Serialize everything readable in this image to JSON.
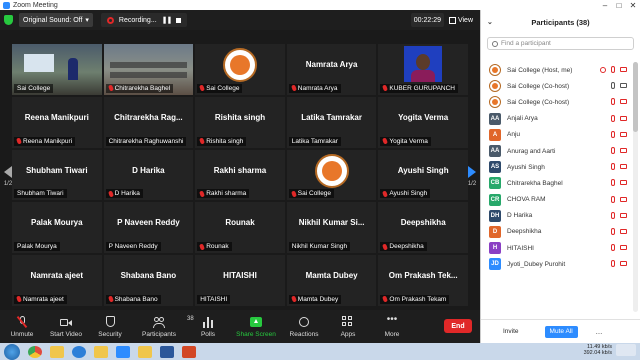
{
  "window": {
    "title": "Zoom Meeting"
  },
  "topbar": {
    "sound_label": "Original Sound: Off",
    "recording_label": "Recording...",
    "timer": "00:22:29",
    "view_label": "View"
  },
  "gallery": {
    "tiles": [
      {
        "big": "",
        "name": "Sai College",
        "muted": false,
        "kind": "classroom"
      },
      {
        "big": "",
        "name": "Chitrarekha Baghel",
        "muted": true,
        "kind": "classroom2"
      },
      {
        "big": "",
        "name": "Sai College",
        "muted": true,
        "kind": "logo"
      },
      {
        "big": "Namrata Arya",
        "name": "Namrata Arya",
        "muted": true,
        "kind": "text"
      },
      {
        "big": "",
        "name": "KUBER GURUPANCH",
        "muted": true,
        "kind": "portrait"
      },
      {
        "big": "Reena Manikpuri",
        "name": "Reena Manikpuri",
        "muted": true,
        "kind": "text"
      },
      {
        "big": "Chitrarekha Rag...",
        "name": "Chitrarekha Raghuwanshi",
        "muted": false,
        "kind": "text"
      },
      {
        "big": "Rishita singh",
        "name": "Rishita singh",
        "muted": true,
        "kind": "text"
      },
      {
        "big": "Latika Tamrakar",
        "name": "Latika Tamrakar",
        "muted": false,
        "kind": "text"
      },
      {
        "big": "Yogita Verma",
        "name": "Yogita Verma",
        "muted": true,
        "kind": "text"
      },
      {
        "big": "Shubham Tiwari",
        "name": "Shubham Tiwari",
        "muted": false,
        "kind": "text"
      },
      {
        "big": "D Harika",
        "name": "D Harika",
        "muted": true,
        "kind": "text"
      },
      {
        "big": "Rakhi sharma",
        "name": "Rakhi sharma",
        "muted": true,
        "kind": "text"
      },
      {
        "big": "",
        "name": "Sai College",
        "muted": true,
        "kind": "logo"
      },
      {
        "big": "Ayushi Singh",
        "name": "Ayushi Singh",
        "muted": true,
        "kind": "text"
      },
      {
        "big": "Palak Mourya",
        "name": "Palak Mourya",
        "muted": false,
        "kind": "text"
      },
      {
        "big": "P Naveen Reddy",
        "name": "P Naveen Reddy",
        "muted": false,
        "kind": "text"
      },
      {
        "big": "Rounak",
        "name": "Rounak",
        "muted": true,
        "kind": "text"
      },
      {
        "big": "Nikhil Kumar Si...",
        "name": "Nikhil Kumar Singh",
        "muted": false,
        "kind": "text"
      },
      {
        "big": "Deepshikha",
        "name": "Deepshikha",
        "muted": true,
        "kind": "text"
      },
      {
        "big": "Namrata ajeet",
        "name": "Namrata ajeet",
        "muted": true,
        "kind": "text"
      },
      {
        "big": "Shabana Bano",
        "name": "Shabana Bano",
        "muted": true,
        "kind": "text"
      },
      {
        "big": "HITAISHI",
        "name": "HITAISHI",
        "muted": false,
        "kind": "text"
      },
      {
        "big": "Mamta Dubey",
        "name": "Mamta Dubey",
        "muted": true,
        "kind": "text"
      },
      {
        "big": "Om Prakash Tek...",
        "name": "Om Prakash Tekam",
        "muted": true,
        "kind": "text"
      }
    ],
    "page_left": "1/2",
    "page_right": "1/2"
  },
  "toolbar": {
    "unmute": "Unmute",
    "start_video": "Start Video",
    "security": "Security",
    "participants": "Participants",
    "participants_count": "38",
    "polls": "Polls",
    "share_screen": "Share Screen",
    "reactions": "Reactions",
    "apps": "Apps",
    "more": "More",
    "end": "End"
  },
  "panel": {
    "title": "Participants (38)",
    "search_placeholder": "Find a participant",
    "participants": [
      {
        "name": "Sai College (Host, me)",
        "initials": "",
        "color": "",
        "logo": true,
        "rec": true,
        "mic_on": false,
        "cam_on": false
      },
      {
        "name": "Sai College (Co-host)",
        "initials": "",
        "color": "",
        "logo": true,
        "rec": false,
        "mic_on": true,
        "cam_on": true
      },
      {
        "name": "Sai College (Co-host)",
        "initials": "",
        "color": "",
        "logo": true,
        "rec": false,
        "mic_on": false,
        "cam_on": false
      },
      {
        "name": "Anjali Arya",
        "initials": "AA",
        "color": "#4a5a6a",
        "logo": false,
        "rec": false,
        "mic_on": false,
        "cam_on": false
      },
      {
        "name": "Anju",
        "initials": "A",
        "color": "#e0662a",
        "logo": false,
        "rec": false,
        "mic_on": false,
        "cam_on": false
      },
      {
        "name": "Anurag and Aarti",
        "initials": "AA",
        "color": "#4a5a6a",
        "logo": false,
        "rec": false,
        "mic_on": false,
        "cam_on": false
      },
      {
        "name": "Ayushi Singh",
        "initials": "AS",
        "color": "#2e4a6b",
        "logo": false,
        "rec": false,
        "mic_on": false,
        "cam_on": false
      },
      {
        "name": "Chitrarekha Baghel",
        "initials": "CB",
        "color": "#27a86a",
        "logo": false,
        "rec": false,
        "mic_on": false,
        "cam_on": false
      },
      {
        "name": "CHOVA RAM",
        "initials": "CR",
        "color": "#27a86a",
        "logo": false,
        "rec": false,
        "mic_on": false,
        "cam_on": false
      },
      {
        "name": "D Harika",
        "initials": "DH",
        "color": "#2e4a6b",
        "logo": false,
        "rec": false,
        "mic_on": false,
        "cam_on": false
      },
      {
        "name": "Deepshikha",
        "initials": "D",
        "color": "#e0662a",
        "logo": false,
        "rec": false,
        "mic_on": false,
        "cam_on": false
      },
      {
        "name": "HITAISHI",
        "initials": "H",
        "color": "#8a3fc4",
        "logo": false,
        "rec": false,
        "mic_on": false,
        "cam_on": false
      },
      {
        "name": "Jyoti_Dubey Purohit",
        "initials": "JD",
        "color": "#2D8CFF",
        "logo": false,
        "rec": false,
        "mic_on": false,
        "cam_on": false
      }
    ],
    "invite": "Invite",
    "mute_all": "Mute All",
    "more": "..."
  },
  "taskbar": {
    "speed_up": "11.49 kb/s",
    "speed_down": "392.04 kb/s"
  }
}
